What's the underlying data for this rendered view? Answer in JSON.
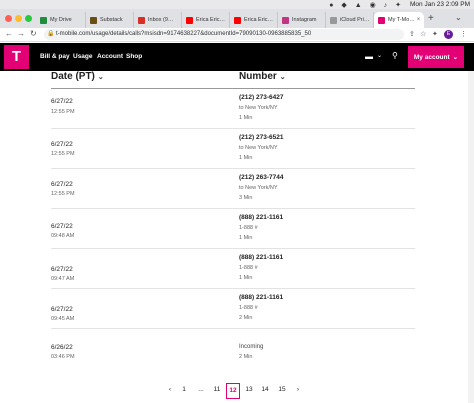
{
  "system": {
    "status_icons": "● ◆ ▲ ◉ ♪ ✦",
    "clock": "Mon Jan 23  2:09 PM"
  },
  "browser": {
    "tabs": [
      {
        "label": "My Drive",
        "icon": "drive-icon",
        "color": "#1e8e3e"
      },
      {
        "label": "Substack",
        "icon": "substack-icon",
        "color": "#6b4e16"
      },
      {
        "label": "Inbox (9…",
        "icon": "gmail-icon",
        "color": "#d93025"
      },
      {
        "label": "Erica Eric…",
        "icon": "youtube-icon",
        "color": "#ff0000"
      },
      {
        "label": "Erica Eric…",
        "icon": "youtube-icon",
        "color": "#ff0000"
      },
      {
        "label": "Instagram",
        "icon": "instagram-icon",
        "color": "#c13584"
      },
      {
        "label": "iCloud Pri…",
        "icon": "icloud-icon",
        "color": "#999999"
      },
      {
        "label": "My T-Mo…",
        "icon": "tmobile-icon",
        "color": "#e20074"
      }
    ],
    "url": "t-mobile.com/usage/details/calls?msisdn=9174638227&documentId=79090130-0963885835_50",
    "profile_initial": "E"
  },
  "site": {
    "logo": "T",
    "nav": [
      "Bill & pay",
      "Usage",
      "Account",
      "Shop"
    ],
    "my_account": "My account",
    "brand_color": "#e20074"
  },
  "table": {
    "date_header": "Date (PT)",
    "number_header": "Number",
    "rows": [
      {
        "date": "6/27/22",
        "time": "12:55 PM",
        "number": "(212) 273-6427",
        "location": "to New York/NY",
        "duration": "1 Min"
      },
      {
        "date": "6/27/22",
        "time": "12:55 PM",
        "number": "(212) 273-6521",
        "location": "to New York/NY",
        "duration": "1 Min"
      },
      {
        "date": "6/27/22",
        "time": "12:55 PM",
        "number": "(212) 263-7744",
        "location": "to New York/NY",
        "duration": "3 Min"
      },
      {
        "date": "6/27/22",
        "time": "09:48 AM",
        "number": "(888) 221-1161",
        "location": "1-888 #",
        "duration": "1 Min"
      },
      {
        "date": "6/27/22",
        "time": "09:47 AM",
        "number": "(888) 221-1161",
        "location": "1-888 #",
        "duration": "1 Min"
      },
      {
        "date": "6/27/22",
        "time": "09:45 AM",
        "number": "(888) 221-1161",
        "location": "1-888 #",
        "duration": "2 Min"
      },
      {
        "date": "6/26/22",
        "time": "03:46 PM",
        "number": "Incoming",
        "location": "2 Min",
        "duration": ""
      }
    ]
  },
  "pagination": {
    "prev": "‹",
    "pages": [
      "1",
      "...",
      "11",
      "12",
      "13",
      "14",
      "15"
    ],
    "current": "12",
    "next": "›"
  }
}
